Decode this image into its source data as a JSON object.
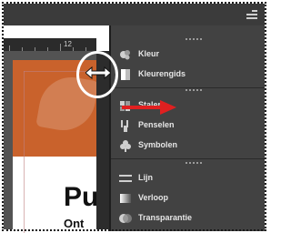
{
  "ruler": {
    "label": "12"
  },
  "document": {
    "title": "Pu",
    "subtitle": "Ont"
  },
  "panel": {
    "groups": [
      {
        "items": [
          {
            "label": "Kleur",
            "icon": "color-icon"
          },
          {
            "label": "Kleurengids",
            "icon": "color-guide-icon"
          }
        ]
      },
      {
        "items": [
          {
            "label": "Stalen",
            "icon": "swatches-icon"
          },
          {
            "label": "Penselen",
            "icon": "brushes-icon"
          },
          {
            "label": "Symbolen",
            "icon": "symbols-icon"
          }
        ]
      },
      {
        "items": [
          {
            "label": "Lijn",
            "icon": "stroke-icon"
          },
          {
            "label": "Verloop",
            "icon": "gradient-icon"
          },
          {
            "label": "Transparantie",
            "icon": "transparency-icon"
          }
        ]
      }
    ]
  },
  "colors": {
    "accent": "#c9622c",
    "arrow": "#e02020",
    "panel_bg": "#424242"
  }
}
